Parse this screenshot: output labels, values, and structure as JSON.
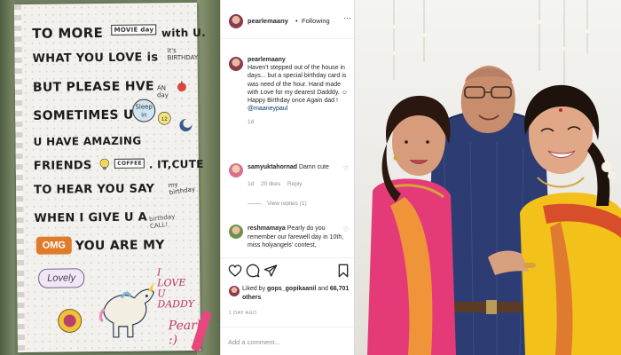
{
  "card": {
    "lines": [
      "TO MORE",
      "WHAT YOU LOVE is",
      "BUT PLEASE HVE",
      "SOMETIMES U",
      "U HAVE AMAZING",
      "FRIENDS",
      "TO HEAR YOU SAY",
      "WHEN I GIVE U A",
      "YOU ARE MY"
    ],
    "with_u": "with U.",
    "its_cute": ". IT,CUTE",
    "omg": "OMG",
    "lovely": "Lovely",
    "love_daddy": [
      "I",
      "LOVE",
      "U",
      "DADDY"
    ],
    "signature": "Pearl :)",
    "stickers": [
      "MOVIE day",
      "it's BIRTHDAY",
      "AN day",
      "Sleep in",
      "COFFEE",
      "my birthday",
      "birthday CALL!"
    ]
  },
  "post": {
    "header": {
      "handle": "pearlemaany",
      "separator": "•",
      "follow_status": "Following",
      "more_label": "···"
    },
    "caption": {
      "handle": "pearlemaany",
      "text": "Haven't stepped out of the house in days... but a special birthday card is was need of the hour. Hand made with Love for my dearest Dadddy. ☺ Happy Birthday once Again dad !",
      "mention": "@maaneypaul",
      "time": "1d"
    },
    "comments": [
      {
        "handle": "samyuktahornad",
        "text": "Damn cute",
        "time": "1d",
        "likes": "20 likes",
        "reply_label": "Reply",
        "view_replies": "View replies (1)"
      },
      {
        "handle": "reshmamaya",
        "text": "Pearly do you remember our farewell day in 10th, miss holyangels' contest,"
      }
    ],
    "likes": {
      "prefix": "Liked by",
      "user": "gops_gopikaanil",
      "and": "and",
      "count": "66,701 others"
    },
    "post_time": "1 DAY AGO",
    "comment_input": {
      "placeholder": "Add a comment..."
    }
  },
  "icons": [
    "heart-icon",
    "comment-icon",
    "share-icon",
    "bookmark-icon"
  ],
  "colors": {
    "ig_text": "#262626",
    "ig_secondary": "#8e8e8e",
    "ig_link": "#00376b",
    "saree_pink": "#e43a78",
    "saree_yellow": "#f2c21b"
  }
}
